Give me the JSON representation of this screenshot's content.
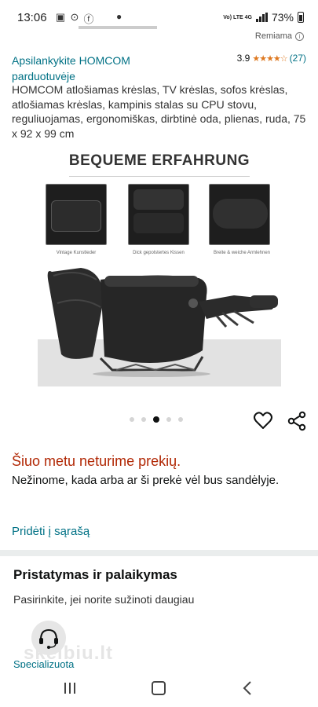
{
  "status_bar": {
    "time": "13:06",
    "battery": "73%",
    "network": "Vo) LTE 4G"
  },
  "ad": {
    "label": "Remiama"
  },
  "product": {
    "store_link": "Apsilankykite HOMCOM parduotuvėje",
    "rating": "3.9",
    "stars": "★★★★☆",
    "rating_count": "(27)",
    "title": "HOMCOM atlošiamas krėslas, TV krėslas, sofos krėslas, atlošiamas krėslas, kampinis stalas su CPU stovu, reguliuojamas, ergonomiškas, dirbtinė oda, plienas, ruda, 75 x 92 x 99 cm"
  },
  "image": {
    "heading": "BEQUEME ERFAHRUNG",
    "captions": [
      "Vintage Kunstleder",
      "Dick gepolstertes Kissen",
      "Breite & weiche Armlehnen"
    ],
    "carousel_dots": 5,
    "active_dot": 2,
    "chair_color": "#2b2b2b"
  },
  "availability": {
    "status": "Šiuo metu neturime prekių.",
    "description": "Nežinome, kada arba ar ši prekė vėl bus sandėlyje.",
    "add_to_list": "Pridėti į sąrašą"
  },
  "delivery": {
    "title": "Pristatymas ir palaikymas",
    "subtitle": "Pasirinkite, jei norite sužinoti daugiau",
    "support_label": "Specializuota"
  },
  "watermark": "skelbiu.lt",
  "colors": {
    "link": "#007185",
    "alert": "#b12704",
    "star": "#de7921"
  }
}
